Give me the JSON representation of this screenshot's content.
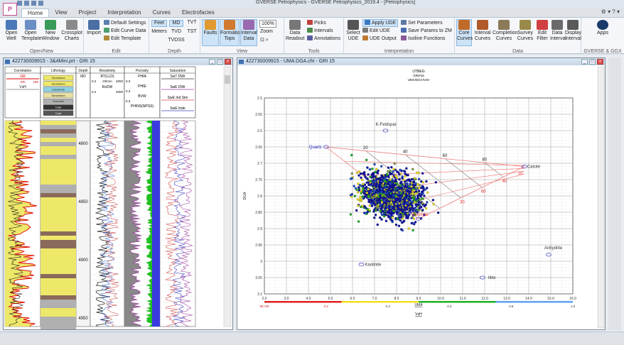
{
  "app": {
    "title": "GVERSE Petrophysics - GVERSE Petrophysics_2019.4 - [Petrophysics]",
    "logo": "P"
  },
  "tabs": [
    "Home",
    "View",
    "Project",
    "Interpretation",
    "Curves",
    "Electrofacies"
  ],
  "ribbon": {
    "open_new": {
      "label": "Open/New",
      "open_well": "Open Well",
      "open_template": "Open Template",
      "new_window": "New Window",
      "crossplot_charts": "Crossplot Charts"
    },
    "edit": {
      "label": "Edit",
      "import": "Import",
      "default_settings": "Default Settings",
      "edit_curve_data": "Edit Curve Data",
      "edit_template": "Edit Template"
    },
    "depth": {
      "label": "Depth",
      "feet": "Feet",
      "meters": "Meters",
      "md": "MD",
      "tvd": "TVD",
      "tvdss": "TVDSS",
      "tvt": "TVT",
      "tst": "TST"
    },
    "view": {
      "label": "View",
      "faults": "Faults",
      "formation_tops": "Formation Tops",
      "interval_data": "Interval Data",
      "zoom": "Zoom",
      "zoom_value": "100%"
    },
    "tools": {
      "label": "Tools",
      "data_readout": "Data Readout",
      "picks": "Picks",
      "intervals": "Intervals",
      "annotations": "Annotations"
    },
    "interpretation": {
      "label": "Interpretation",
      "select_ude": "Select UDE",
      "apply_ude": "Apply UDE",
      "edit_ude": "Edit UDE",
      "ude_output": "UDE Output",
      "set_parameters": "Set Parameters",
      "save_params": "Save Params to ZM",
      "isoline_functions": "Isoline Functions"
    },
    "data": {
      "label": "Data",
      "core_curves": "Core Curves",
      "interval_curves": "Interval Curves",
      "completion_curves": "Completion Curves",
      "survey_curves": "Survey Curves",
      "edit_filter": "Edit Filter",
      "data_interval": "Data Interval",
      "display_interval": "Display Interval"
    },
    "gverse": {
      "label": "GVERSE & GGX",
      "apps": "Apps"
    }
  },
  "log_window": {
    "title": "422730009915 - 3&4Mini.prt - GRI 15",
    "tracks": {
      "correlation": {
        "name": "Correlation",
        "curves": [
          "GR",
          "API",
          "150",
          "VsH"
        ]
      },
      "lithology": {
        "name": "Lithology",
        "items": [
          "Sandstone",
          "Sandstone",
          "Limestone",
          "Sandstone",
          "Dolomite",
          "Coal",
          "Coal"
        ]
      },
      "depth": {
        "name": "Depth",
        "unit": "MD"
      },
      "resistivity": {
        "name": "Resistivity",
        "curves": [
          "RT(LLD)",
          "0.2",
          "Ohmm",
          "2000",
          "RxDW",
          "0.2",
          "2000"
        ]
      },
      "porosity": {
        "name": "Porosity",
        "curves": [
          "PHIA",
          "0.3",
          "PHIE",
          "0.3",
          "BVW",
          "0.3",
          "PHINS(NPSS)"
        ]
      },
      "saturation": {
        "name": "Saturation",
        "curves": [
          "SwT DWr",
          "SwE DWr",
          "SwE Ind Sim",
          "SwE Inde"
        ]
      }
    },
    "depth_labels": [
      "4800",
      "4850",
      "4900",
      "4950"
    ]
  },
  "chart_window": {
    "title": "422730009915 - UMA DGA.cht - GRI 15"
  },
  "chart_data": {
    "type": "scatter",
    "title": "UTBEG",
    "subtitle": "GRI#15",
    "subtitle2": "UMA/DGA/VsH",
    "xlabel": "UMA",
    "ylabel": "DGA",
    "xlim": [
      2.0,
      16.0
    ],
    "ylim": [
      3.1,
      2.5
    ],
    "xticks": [
      "2.0",
      "3.0",
      "4.0",
      "5.0",
      "6.0",
      "7.0",
      "8.0",
      "9.0",
      "10.0",
      "11.0",
      "12.0",
      "13.0",
      "14.0",
      "15.0",
      "16.0"
    ],
    "yticks": [
      "2.5",
      "2.55",
      "2.6",
      "2.65",
      "2.7",
      "2.75",
      "2.8",
      "2.85",
      "2.9",
      "2.95",
      "3",
      "3.05",
      "3.1"
    ],
    "minerals": [
      {
        "name": "K-Feldspar",
        "x": 7.5,
        "y": 2.6
      },
      {
        "name": "Quartz",
        "x": 4.8,
        "y": 2.65
      },
      {
        "name": "Calcite",
        "x": 13.8,
        "y": 2.71
      },
      {
        "name": "Dolomite",
        "x": 9.0,
        "y": 2.87
      },
      {
        "name": "Anhydrite",
        "x": 14.9,
        "y": 2.98
      },
      {
        "name": "Kaolinite",
        "x": 6.4,
        "y": 3.01
      },
      {
        "name": "Illite",
        "x": 11.9,
        "y": 3.05
      }
    ],
    "isolines": [
      "20",
      "40",
      "60",
      "80",
      "20",
      "40",
      "60",
      "30"
    ],
    "colorbar": {
      "label": "VsH",
      "ticks": [
        "0E+00",
        "0.2",
        "0.4",
        "0.6",
        "0.8",
        "1.0"
      ],
      "colors": [
        "#e02020",
        "#f0e020",
        "#20b020",
        "#60a0f0",
        "#1010a0"
      ]
    },
    "grid": true
  }
}
